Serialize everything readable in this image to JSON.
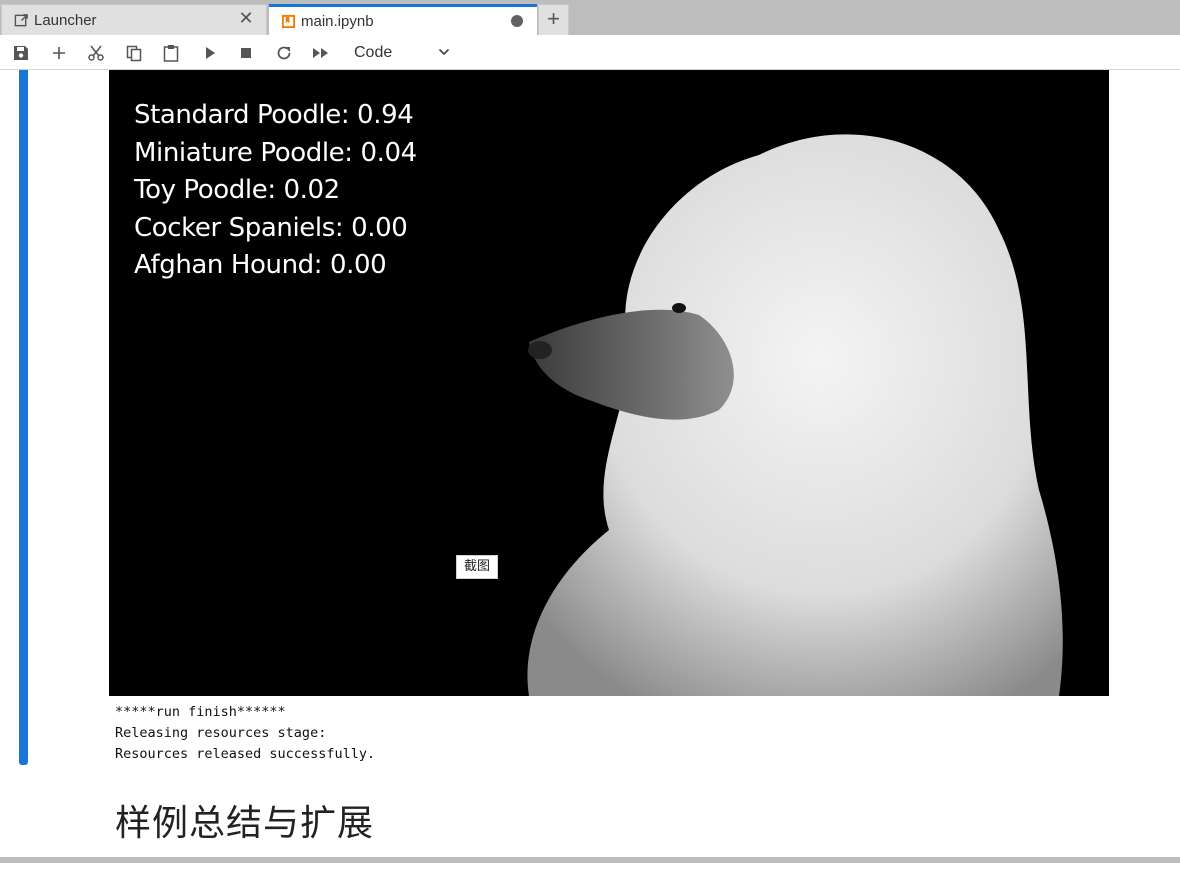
{
  "tabs": [
    {
      "label": "Launcher",
      "icon": "launch-icon",
      "active": false
    },
    {
      "label": "main.ipynb",
      "icon": "notebook-icon",
      "active": true,
      "dirty": true
    }
  ],
  "new_tab": "+",
  "toolbar": {
    "buttons": [
      "save-icon",
      "add-cell-icon",
      "cut-icon",
      "copy-icon",
      "paste-icon",
      "run-icon",
      "stop-icon",
      "restart-icon",
      "run-all-icon"
    ],
    "cell_type": "Code"
  },
  "output": {
    "predictions": [
      "Standard Poodle: 0.94",
      "Miniature Poodle: 0.04",
      "Toy Poodle: 0.02",
      "Cocker Spaniels: 0.00",
      "Afghan Hound: 0.00"
    ],
    "screenshot_tip": "截图",
    "stdout": [
      "*****run finish******",
      "Releasing resources stage:",
      "Resources released successfully."
    ]
  },
  "markdown": {
    "heading": "样例总结与扩展"
  },
  "colors": {
    "accent": "#1976d2",
    "tab_bar": "#bdbdbd",
    "notebook_icon": "#f57c00"
  }
}
